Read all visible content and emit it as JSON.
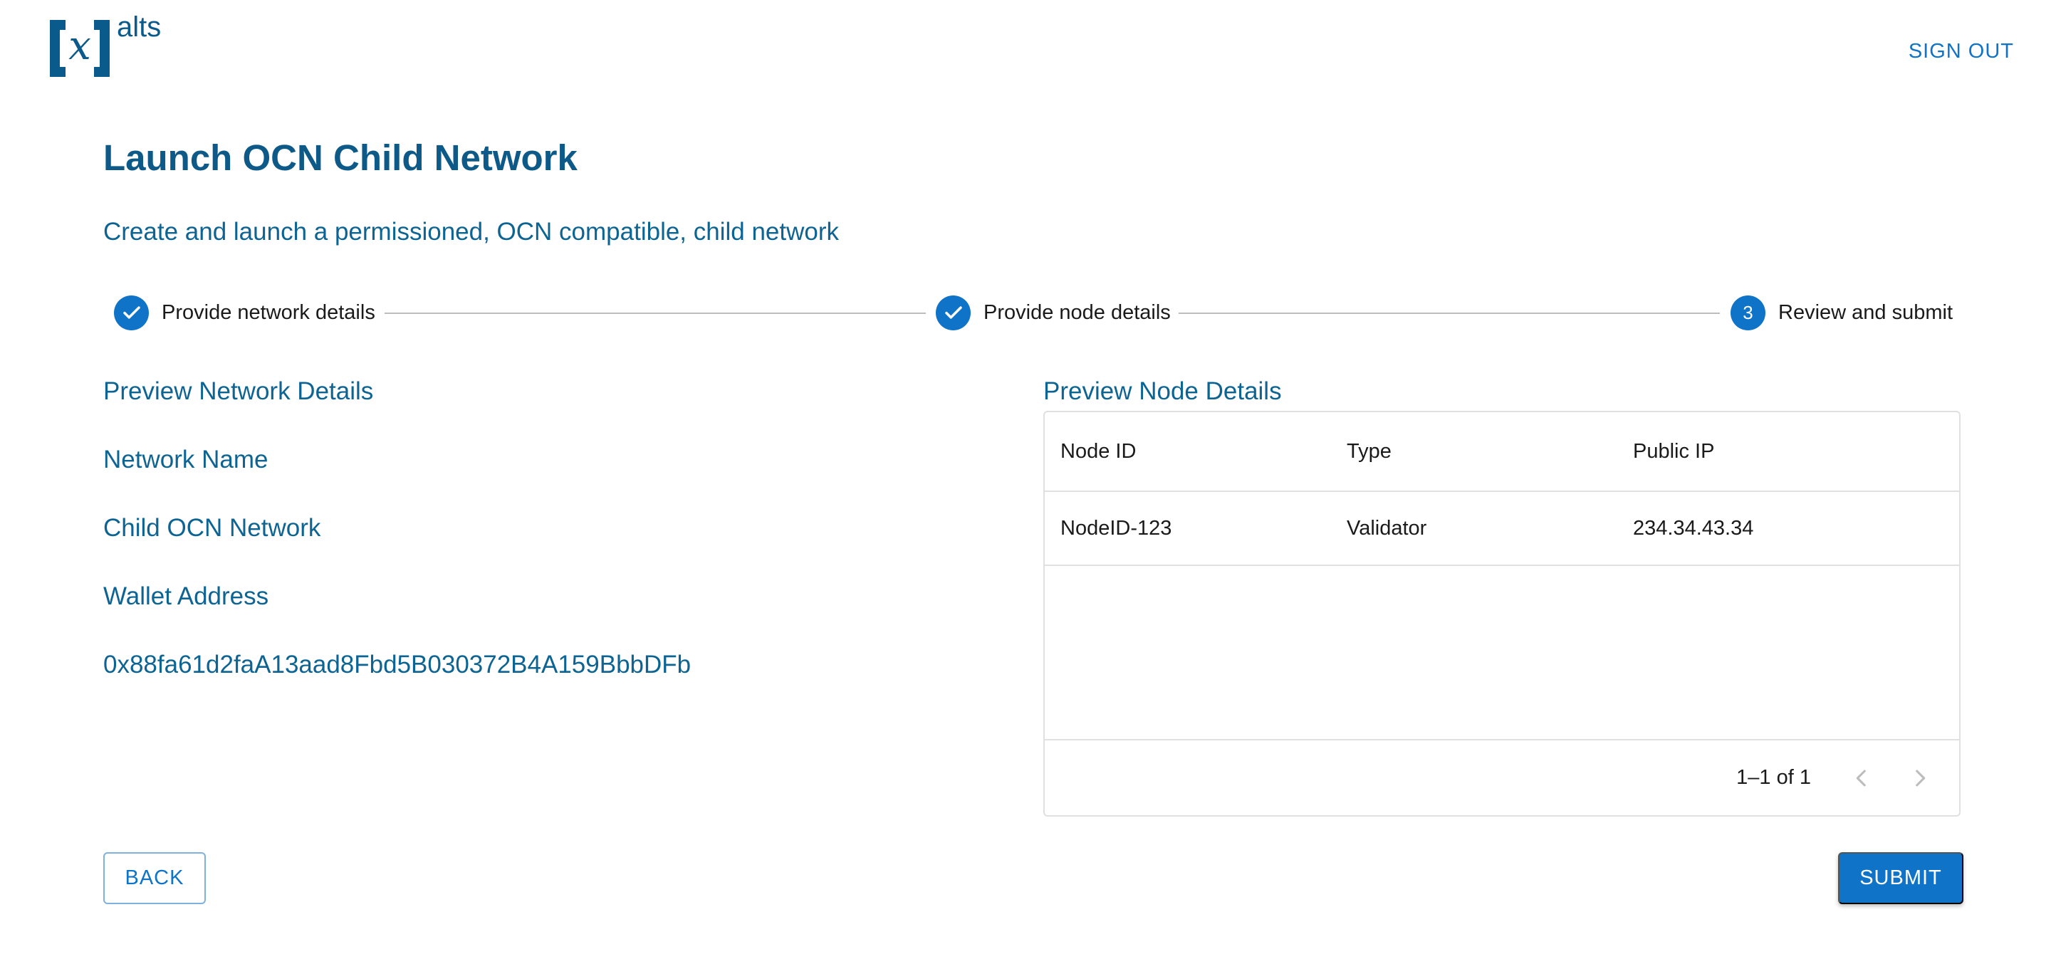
{
  "brand": {
    "logo_letter": "x",
    "logo_text": "alts"
  },
  "header": {
    "signout_label": "SIGN OUT"
  },
  "page": {
    "title": "Launch OCN Child Network",
    "subtitle": "Create and launch a permissioned, OCN compatible, child network"
  },
  "stepper": {
    "steps": [
      {
        "label": "Provide network details",
        "state": "completed"
      },
      {
        "label": "Provide node details",
        "state": "completed"
      },
      {
        "label": "Review and submit",
        "number": "3",
        "state": "active"
      }
    ]
  },
  "network_preview": {
    "heading": "Preview Network Details",
    "name_label": "Network Name",
    "name_value": "Child OCN Network",
    "wallet_label": "Wallet Address",
    "wallet_value": "0x88fa61d2faA13aad8Fbd5B030372B4A159BbbDFb"
  },
  "node_preview": {
    "heading": "Preview Node Details",
    "columns": [
      "Node ID",
      "Type",
      "Public IP"
    ],
    "rows": [
      [
        "NodeID-123",
        "Validator",
        "234.34.43.34"
      ]
    ],
    "pagination_text": "1–1 of 1"
  },
  "actions": {
    "back_label": "BACK",
    "submit_label": "SUBMIT"
  },
  "colors": {
    "primary": "#0f73c8",
    "heading": "#0d5a88",
    "text_accent": "#0d6493"
  }
}
